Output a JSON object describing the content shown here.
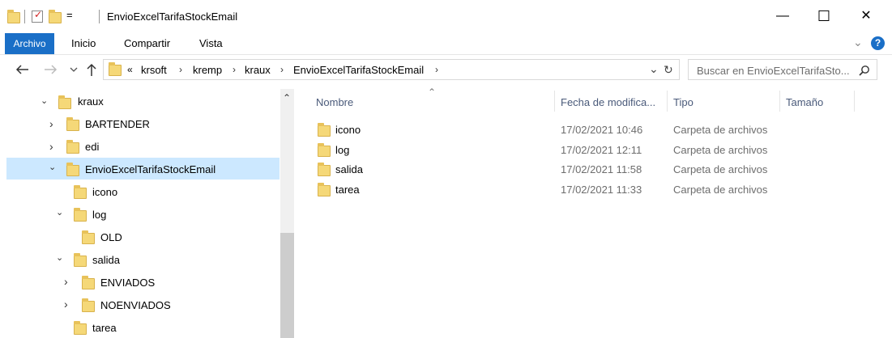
{
  "window": {
    "title": "EnvioExcelTarifaStockEmail",
    "qat_dropdown": "=",
    "minimize": "—",
    "maximize": "☐",
    "close": "✕"
  },
  "ribbon": {
    "tabs": [
      "Archivo",
      "Inicio",
      "Compartir",
      "Vista"
    ],
    "expand": "⌄",
    "help": "?"
  },
  "address": {
    "overflow": "«",
    "crumbs": [
      "krsoft",
      "kremp",
      "kraux",
      "EnvioExcelTarifaStockEmail"
    ],
    "separator": "›",
    "refresh": "↻",
    "dropdown": "⌄"
  },
  "search": {
    "placeholder": "Buscar en EnvioExcelTarifaSto..."
  },
  "nav": {
    "items": [
      {
        "label": "kraux",
        "chevron": "⌄"
      },
      {
        "label": "BARTENDER",
        "chevron": "›"
      },
      {
        "label": "edi",
        "chevron": "›"
      },
      {
        "label": "EnvioExcelTarifaStockEmail",
        "chevron": "⌄"
      },
      {
        "label": "icono",
        "chevron": ""
      },
      {
        "label": "log",
        "chevron": "⌄"
      },
      {
        "label": "OLD",
        "chevron": ""
      },
      {
        "label": "salida",
        "chevron": "⌄"
      },
      {
        "label": "ENVIADOS",
        "chevron": "›"
      },
      {
        "label": "NOENVIADOS",
        "chevron": "›"
      },
      {
        "label": "tarea",
        "chevron": ""
      }
    ],
    "scroll_up": "⌃"
  },
  "list": {
    "sort_indicator": "⌃",
    "columns": [
      "Nombre",
      "Fecha de modifica...",
      "Tipo",
      "Tamaño"
    ],
    "rows": [
      {
        "name": "icono",
        "date": "17/02/2021 10:46",
        "type": "Carpeta de archivos"
      },
      {
        "name": "log",
        "date": "17/02/2021 12:11",
        "type": "Carpeta de archivos"
      },
      {
        "name": "salida",
        "date": "17/02/2021 11:58",
        "type": "Carpeta de archivos"
      },
      {
        "name": "tarea",
        "date": "17/02/2021 11:33",
        "type": "Carpeta de archivos"
      }
    ]
  },
  "colors": {
    "accent": "#1a6fc7",
    "selection": "#cce8ff",
    "folder": "#f5d878"
  }
}
